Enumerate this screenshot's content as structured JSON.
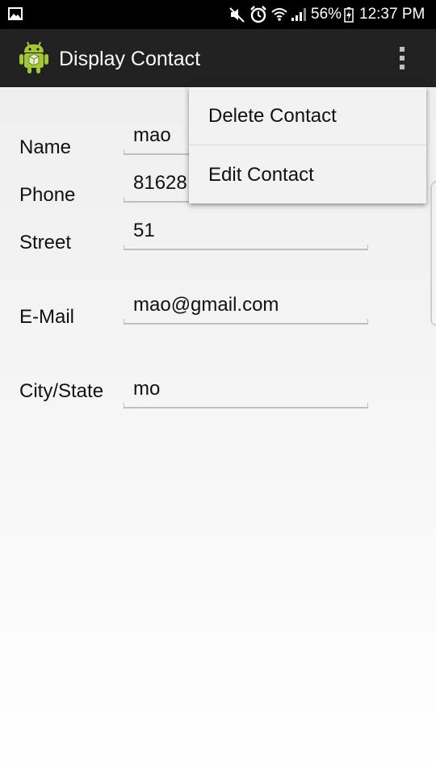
{
  "status_bar": {
    "battery_percent": "56%",
    "time": "12:37 PM",
    "icons": [
      "gallery-icon",
      "mute-icon",
      "alarm-icon",
      "wifi-icon",
      "signal-icon",
      "battery-icon"
    ]
  },
  "action_bar": {
    "title": "Display Contact",
    "app_icon": "android-icon",
    "overflow_icon": "overflow-menu-icon"
  },
  "form": {
    "name_label": "Name",
    "name_value": "mao",
    "phone_label": "Phone",
    "phone_value": "81628",
    "street_label": "Street",
    "street_value": "51",
    "email_label": "E-Mail",
    "email_value": "mao@gmail.com",
    "city_label": "City/State",
    "city_value": "mo"
  },
  "menu": {
    "items": [
      {
        "label": "Delete Contact"
      },
      {
        "label": "Edit Contact"
      }
    ]
  },
  "colors": {
    "status_bar": "#000000",
    "action_bar": "#212121",
    "android_green": "#a4c639",
    "menu_bg": "#f2f2f2",
    "underline": "#bfbfbf"
  }
}
